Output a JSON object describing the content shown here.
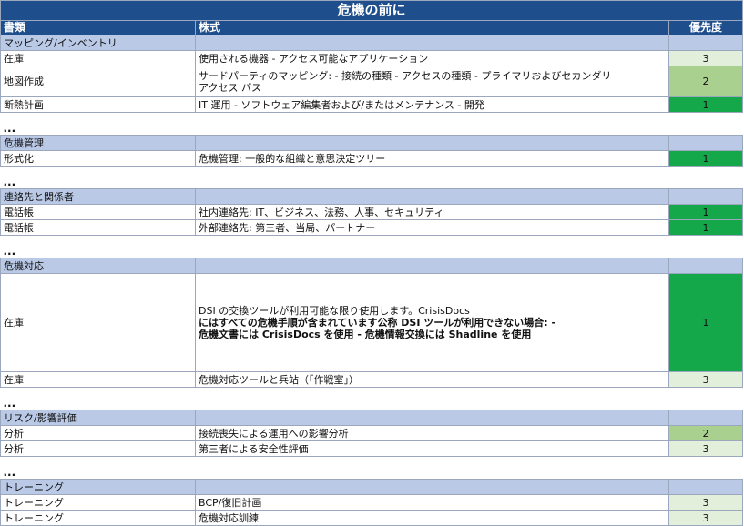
{
  "title": "危機の前に",
  "headers": {
    "type": "書類",
    "format": "株式",
    "priority": "優先度"
  },
  "ellipsis": "...",
  "sections": {
    "mapping": "マッピング/インベントリ",
    "crisis_mgmt": "危機管理",
    "contacts": "連絡先と関係者",
    "response": "危機対応",
    "risk": "リスク/影響評価",
    "training": "トレーニング"
  },
  "rows": {
    "r1": {
      "type": "在庫",
      "format": "使用される機器 - アクセス可能なアプリケーション",
      "priority": "3"
    },
    "r2": {
      "type": "地図作成",
      "format_line1": "サードパーティのマッピング: - 接続の種類 - アクセスの種類 - プライマリおよびセカンダリ",
      "format_line2": "アクセス パス",
      "priority": "2"
    },
    "r3": {
      "type": "断熱計画",
      "format": "IT 運用 - ソフトウェア編集者および/またはメンテナンス - 開発",
      "priority": "1"
    },
    "r4": {
      "type": "形式化",
      "format": "危機管理: 一般的な組織と意思決定ツリー",
      "priority": "1"
    },
    "r5": {
      "type": "電話帳",
      "format": "社内連絡先: IT、ビジネス、法務、人事、セキュリティ",
      "priority": "1"
    },
    "r6": {
      "type": "電話帳",
      "format": "外部連絡先: 第三者、当局、パートナー",
      "priority": "1"
    },
    "r7": {
      "type": "在庫",
      "format_line1": "DSI の交換ツールが利用可能な限り使用します。CrisisDocs",
      "format_line2": "にはすべての危機手順が含まれています公称 DSI ツールが利用できない場合: -",
      "format_line3": "危機文書には CrisisDocs を使用 - 危機情報交換には Shadline を使用",
      "priority": "1"
    },
    "r8": {
      "type": "在庫",
      "format": "危機対応ツールと兵站（「作戦室」）",
      "priority": "3"
    },
    "r9": {
      "type": "分析",
      "format": "接続喪失による運用への影響分析",
      "priority": "2"
    },
    "r10": {
      "type": "分析",
      "format": "第三者による安全性評価",
      "priority": "3"
    },
    "r11": {
      "type": "トレーニング",
      "format": "BCP/復旧計画",
      "priority": "3"
    },
    "r12": {
      "type": "トレーニング",
      "format": "危機対応訓練",
      "priority": "3"
    }
  },
  "colors": {
    "header": "#1f4e8c",
    "section": "#b9c9e6",
    "priority1": "#14a84a",
    "priority2": "#a9d08e",
    "priority3": "#e2efda"
  }
}
